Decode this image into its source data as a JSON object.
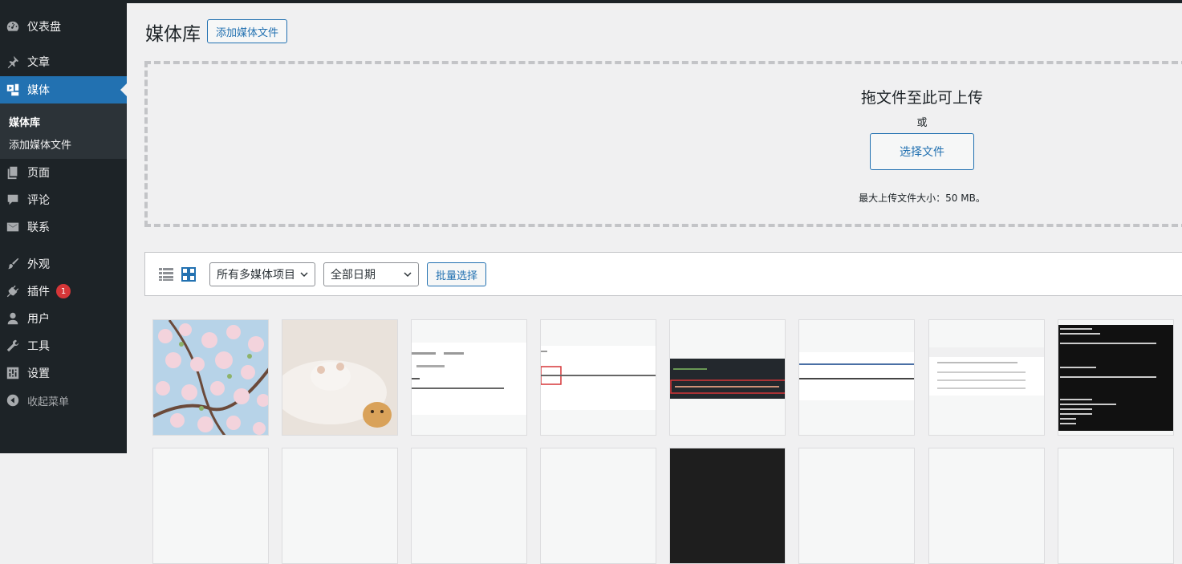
{
  "sidebar": {
    "items": [
      {
        "label": "仪表盘",
        "icon": "dashboard-icon"
      },
      {
        "label": "文章",
        "icon": "pin-icon"
      },
      {
        "label": "媒体",
        "icon": "media-icon"
      },
      {
        "label": "页面",
        "icon": "page-icon"
      },
      {
        "label": "评论",
        "icon": "comment-icon"
      },
      {
        "label": "联系",
        "icon": "mail-icon"
      },
      {
        "label": "外观",
        "icon": "brush-icon"
      },
      {
        "label": "插件",
        "icon": "plugin-icon",
        "badge": "1"
      },
      {
        "label": "用户",
        "icon": "user-icon"
      },
      {
        "label": "工具",
        "icon": "wrench-icon"
      },
      {
        "label": "设置",
        "icon": "settings-icon"
      }
    ],
    "submenu": [
      "媒体库",
      "添加媒体文件"
    ],
    "collapse_label": "收起菜单"
  },
  "header": {
    "title": "媒体库",
    "add_button": "添加媒体文件"
  },
  "uploader": {
    "drop_text": "拖文件至此可上传",
    "or_text": "或",
    "select_button": "选择文件",
    "max_size_text": "最大上传文件大小：50 MB。"
  },
  "toolbar": {
    "filter_type": "所有多媒体项目",
    "filter_date": "全部日期",
    "bulk_select": "批量选择"
  },
  "colors": {
    "accent": "#2271b1",
    "sidebar_bg": "#1d2327",
    "badge": "#d63638"
  }
}
